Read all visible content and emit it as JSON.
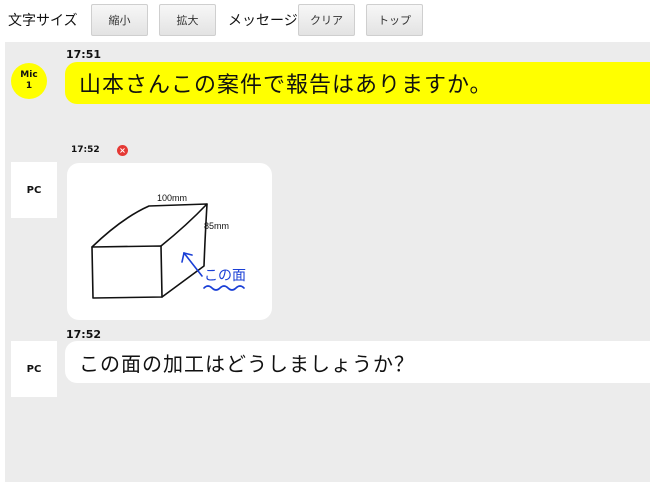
{
  "toolbar": {
    "font_size_label": "文字サイズ",
    "shrink_button": "縮小",
    "enlarge_button": "拡大",
    "message_label": "メッセージ",
    "clear_button": "クリア",
    "top_button": "トップ"
  },
  "messages": [
    {
      "time": "17:51",
      "sender_line1": "Mic",
      "sender_line2": "1",
      "text": "山本さんこの案件で報告はありますか。"
    },
    {
      "time": "17:52",
      "sender": "PC",
      "image_labels": {
        "width": "100mm",
        "height": "85mm",
        "annotation": "この面"
      }
    },
    {
      "time": "17:52",
      "sender": "PC",
      "text": "この面の加工はどうしましょうか？"
    }
  ],
  "colors": {
    "mic_highlight": "#ffff00",
    "chat_background": "#ececec",
    "delete_red": "#e53935",
    "annotation_blue": "#1a3fd6"
  }
}
